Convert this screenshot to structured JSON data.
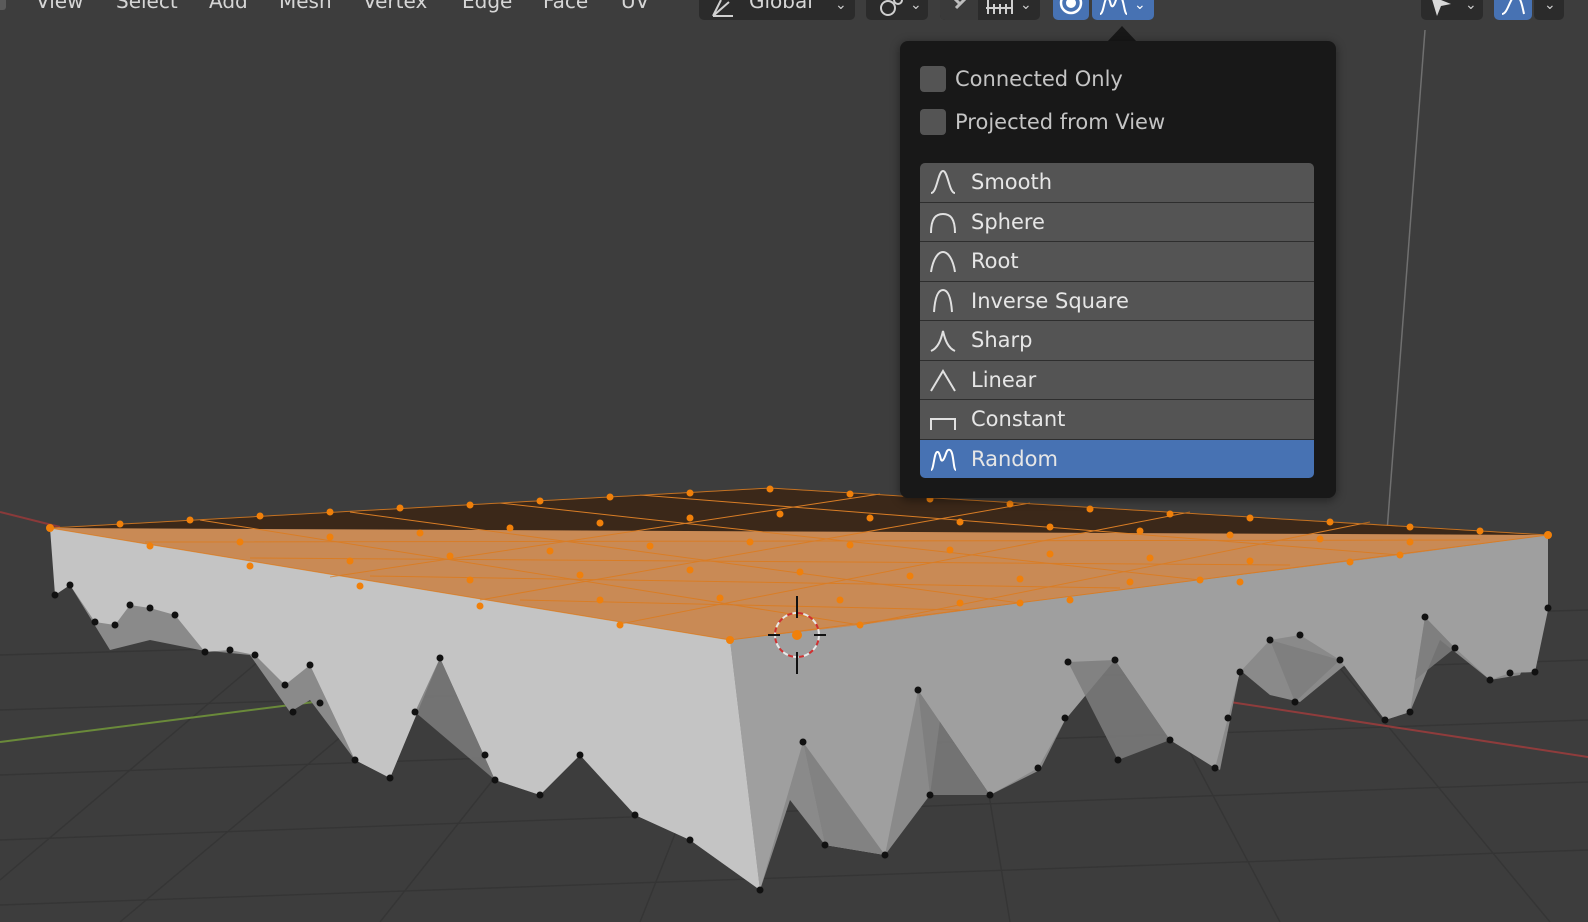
{
  "menu": {
    "items": [
      {
        "id": "view",
        "label": "View"
      },
      {
        "id": "select",
        "label": "Select"
      },
      {
        "id": "add",
        "label": "Add"
      },
      {
        "id": "mesh",
        "label": "Mesh"
      },
      {
        "id": "vertex",
        "label": "Vertex"
      },
      {
        "id": "edge",
        "label": "Edge"
      },
      {
        "id": "face",
        "label": "Face"
      },
      {
        "id": "uv",
        "label": "UV"
      }
    ]
  },
  "header": {
    "orientation_label": "Global"
  },
  "popover": {
    "options": [
      {
        "id": "connected-only",
        "label": "Connected Only",
        "checked": false
      },
      {
        "id": "projected-from-view",
        "label": "Projected from View",
        "checked": false
      }
    ],
    "falloff_types": [
      {
        "id": "smooth",
        "label": "Smooth",
        "icon": "smooth-falloff-icon"
      },
      {
        "id": "sphere",
        "label": "Sphere",
        "icon": "sphere-falloff-icon"
      },
      {
        "id": "root",
        "label": "Root",
        "icon": "root-falloff-icon"
      },
      {
        "id": "inverse-square",
        "label": "Inverse Square",
        "icon": "inverse-square-falloff-icon"
      },
      {
        "id": "sharp",
        "label": "Sharp",
        "icon": "sharp-falloff-icon"
      },
      {
        "id": "linear",
        "label": "Linear",
        "icon": "linear-falloff-icon"
      },
      {
        "id": "constant",
        "label": "Constant",
        "icon": "constant-falloff-icon"
      },
      {
        "id": "random",
        "label": "Random",
        "icon": "random-falloff-icon"
      }
    ],
    "selected_falloff": "Random"
  },
  "colors": {
    "viewport_bg": "#3d3d3d",
    "selection_orange": "#f0800a",
    "accent_blue": "#4772b3",
    "mesh_side": "#a0a0a0",
    "mesh_top": "#c98a55"
  }
}
